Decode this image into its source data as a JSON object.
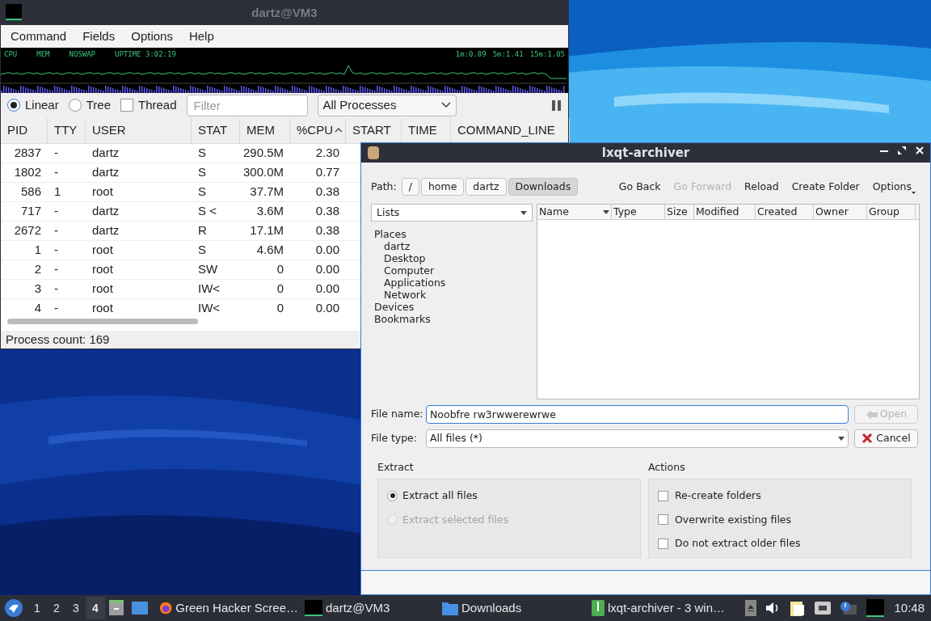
{
  "task_manager": {
    "title": "dartz@VM3",
    "menu": [
      "Command",
      "Fields",
      "Options",
      "Help"
    ],
    "graph": {
      "labels": [
        "CPU",
        "MEM",
        "NOSWAP",
        "UPTIME 3:02:19"
      ],
      "loads": [
        "1m:0.89",
        "5m:1.41",
        "15m:1.05"
      ]
    },
    "view_modes": [
      {
        "label": "Linear",
        "selected": true
      },
      {
        "label": "Tree",
        "selected": false
      }
    ],
    "thread": {
      "label": "Thread",
      "checked": false
    },
    "filter": {
      "placeholder": "Filter"
    },
    "process_filter": "All Processes",
    "columns": [
      {
        "label": "PID",
        "sorted": false
      },
      {
        "label": "TTY",
        "sorted": false
      },
      {
        "label": "USER",
        "sorted": false
      },
      {
        "label": "STAT",
        "sorted": false
      },
      {
        "label": "MEM",
        "sorted": false
      },
      {
        "label": "%CPU",
        "sorted": true
      },
      {
        "label": "START",
        "sorted": false
      },
      {
        "label": "TIME",
        "sorted": false
      },
      {
        "label": "COMMAND_LINE",
        "sorted": false
      }
    ],
    "rows": [
      [
        "2837",
        "-",
        "dartz",
        "S",
        "290.5M",
        "2.30"
      ],
      [
        "1802",
        "-",
        "dartz",
        "S",
        "300.0M",
        "0.77"
      ],
      [
        "586",
        "1",
        "root",
        "S",
        "37.7M",
        "0.38"
      ],
      [
        "717",
        "-",
        "dartz",
        "S <",
        "3.6M",
        "0.38"
      ],
      [
        "2672",
        "-",
        "dartz",
        "R",
        "17.1M",
        "0.38"
      ],
      [
        "1",
        "-",
        "root",
        "S",
        "4.6M",
        "0.00"
      ],
      [
        "2",
        "-",
        "root",
        "SW",
        "0",
        "0.00"
      ],
      [
        "3",
        "-",
        "root",
        "IW<",
        "0",
        "0.00"
      ],
      [
        "4",
        "-",
        "root",
        "IW<",
        "0",
        "0.00"
      ]
    ],
    "status": "Process count: 169"
  },
  "archiver": {
    "title": "lxqt-archiver",
    "path_label": "Path:",
    "crumbs": [
      {
        "label": "/",
        "selected": false
      },
      {
        "label": "home",
        "selected": false
      },
      {
        "label": "dartz",
        "selected": false
      },
      {
        "label": "Downloads",
        "selected": true
      }
    ],
    "toolbar": [
      {
        "label": "Go Back",
        "disabled": false,
        "kind": "button"
      },
      {
        "label": "Go Forward",
        "disabled": true,
        "kind": "button"
      },
      {
        "label": "Reload",
        "disabled": false,
        "kind": "button"
      },
      {
        "label": "Create Folder",
        "disabled": false,
        "kind": "button"
      },
      {
        "label": "Options",
        "disabled": false,
        "kind": "menu"
      }
    ],
    "side_view": "Lists",
    "tree": [
      {
        "label": "Places",
        "children": [
          {
            "label": "dartz"
          },
          {
            "label": "Desktop"
          },
          {
            "label": "Computer"
          },
          {
            "label": "Applications"
          },
          {
            "label": "Network"
          }
        ]
      },
      {
        "label": "Devices"
      },
      {
        "label": "Bookmarks"
      }
    ],
    "file_columns": [
      {
        "label": "Name",
        "sorted": true
      },
      {
        "label": "Type",
        "sorted": false
      },
      {
        "label": "Size",
        "sorted": false
      },
      {
        "label": "Modified",
        "sorted": false
      },
      {
        "label": "Created",
        "sorted": false
      },
      {
        "label": "Owner",
        "sorted": false
      },
      {
        "label": "Group",
        "sorted": false
      }
    ],
    "file_name": {
      "label": "File name:",
      "value": "Noobfre rw3rwwerewrwe"
    },
    "file_type": {
      "label": "File type:",
      "value": "All files (*)"
    },
    "buttons": [
      {
        "label": "Open",
        "disabled": true,
        "kind": "open"
      },
      {
        "label": "Cancel",
        "disabled": false,
        "kind": "cancel"
      }
    ],
    "extract": {
      "title": "Extract",
      "options": [
        {
          "label": "Extract all files",
          "selected": true,
          "disabled": false
        },
        {
          "label": "Extract selected files",
          "selected": false,
          "disabled": true
        }
      ]
    },
    "actions": {
      "title": "Actions",
      "options": [
        {
          "label": "Re-create folders",
          "checked": false
        },
        {
          "label": "Overwrite existing files",
          "checked": false
        },
        {
          "label": "Do not extract older files",
          "checked": false
        }
      ]
    }
  },
  "taskbar": {
    "workspaces": [
      {
        "label": "1",
        "selected": false
      },
      {
        "label": "2",
        "selected": false
      },
      {
        "label": "3",
        "selected": false
      },
      {
        "label": "4",
        "selected": true
      }
    ],
    "tasks": [
      {
        "label": "Green Hacker Scree…",
        "kind": "browser"
      },
      {
        "label": "dartz@VM3",
        "kind": "terminal"
      },
      {
        "label": "Downloads",
        "kind": "folder"
      },
      {
        "label": "lxqt-archiver - 3 win…",
        "kind": "archive"
      }
    ],
    "clock": "10:48"
  }
}
